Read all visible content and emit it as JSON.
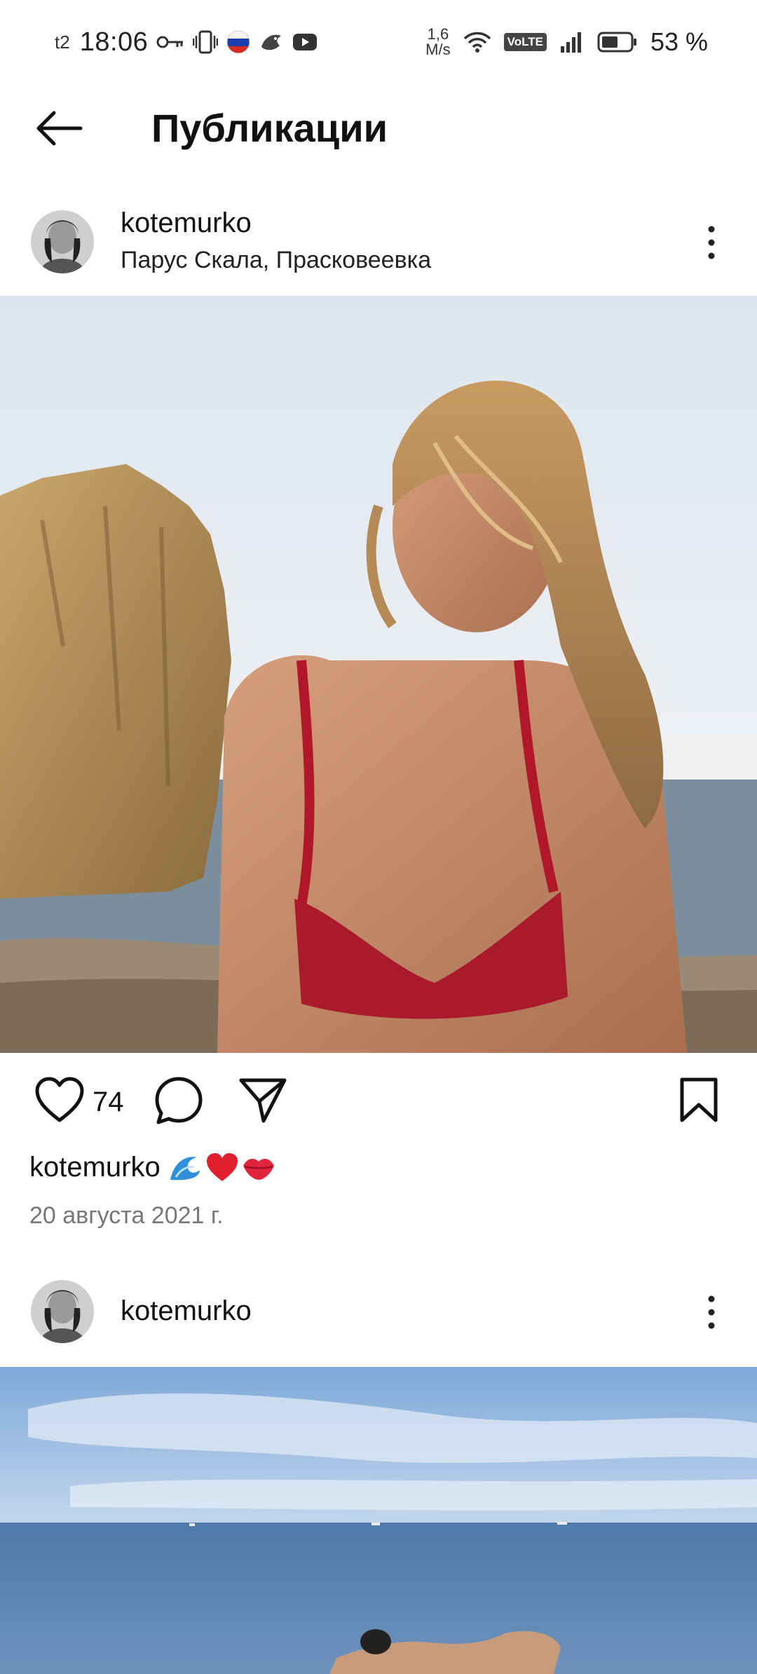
{
  "status_bar": {
    "carrier": "t2",
    "time": "18:06",
    "net_speed_value": "1,6",
    "net_speed_unit": "M/s",
    "volte": "VoLTE",
    "battery_pct": "53 %",
    "icons": [
      "key-icon",
      "vibrate-icon",
      "russia-flag-icon",
      "app-icon",
      "youtube-icon",
      "wifi-icon",
      "signal-icon",
      "battery-icon"
    ]
  },
  "header": {
    "title": "Публикации",
    "back_icon": "arrow-left-icon"
  },
  "posts": [
    {
      "username": "kotemurko",
      "location": "Парус Скала, Прасковеевка",
      "likes": "74",
      "caption_user": "kotemurko",
      "caption_emojis": [
        "wave-emoji",
        "red-heart-emoji",
        "kiss-lips-emoji"
      ],
      "date": "20 августа 2021 г."
    },
    {
      "username": "kotemurko"
    }
  ],
  "colors": {
    "text": "#111111",
    "secondary_text": "#777777",
    "background": "#ffffff"
  }
}
